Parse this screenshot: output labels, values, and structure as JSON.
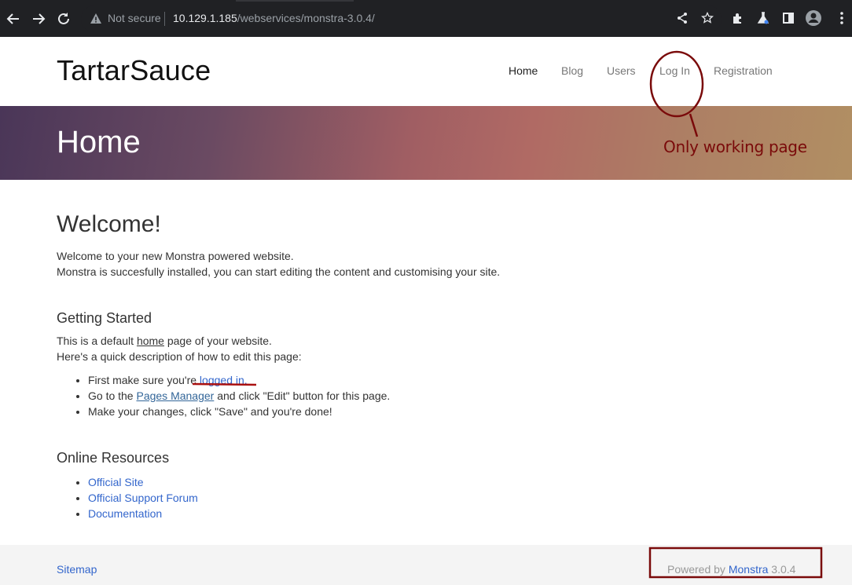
{
  "browser": {
    "security_label": "Not secure",
    "url_host": "10.129.1.185",
    "url_path": "/webservices/monstra-3.0.4/"
  },
  "site": {
    "brand": "TartarSauce",
    "nav": [
      {
        "label": "Home",
        "active": true
      },
      {
        "label": "Blog",
        "active": false
      },
      {
        "label": "Users",
        "active": false
      },
      {
        "label": "Log In",
        "active": false
      },
      {
        "label": "Registration",
        "active": false
      }
    ]
  },
  "hero": {
    "title": "Home"
  },
  "annotation": {
    "note": "Only working page",
    "color": "#7a0a0a"
  },
  "content": {
    "welcome_heading": "Welcome!",
    "welcome_line1": "Welcome to your new Monstra powered website.",
    "welcome_line2": "Monstra is succesfully installed, you can start editing the content and customising your site.",
    "getting_started_heading": "Getting Started",
    "gs_line1_pre": "This is a default ",
    "gs_line1_link": "home",
    "gs_line1_post": " page of your website.",
    "gs_line2": "Here's a quick description of how to edit this page:",
    "step1_pre": "First make sure you're",
    "step1_link": " logged in.",
    "step2_pre": "Go to the ",
    "step2_link": "Pages Manager",
    "step2_post": " and click \"Edit\" button for this page.",
    "step3": "Make your changes, click \"Save\" and you're done!",
    "resources_heading": "Online Resources",
    "resources": [
      "Official Site",
      "Official Support Forum",
      "Documentation"
    ]
  },
  "footer": {
    "sitemap": "Sitemap",
    "powered_pre": "Powered by ",
    "powered_link": "Monstra",
    "powered_version": " 3.0.4"
  },
  "colors": {
    "link": "#3366cc",
    "chrome_bg": "#202124",
    "annotation": "#7a0a0a"
  }
}
